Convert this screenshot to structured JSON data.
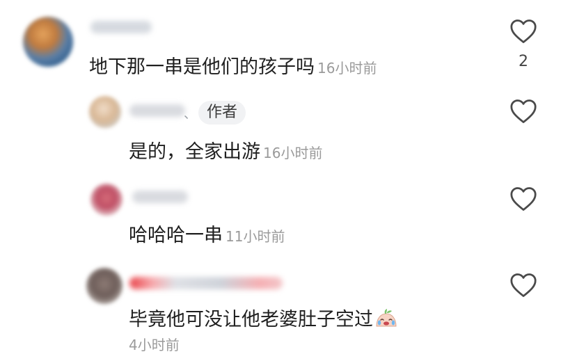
{
  "comments": {
    "main": {
      "text": "地下那一串是他们的孩子吗",
      "time": "16小时前",
      "like_count": "2"
    },
    "replies": [
      {
        "author_badge": "作者",
        "separator": "、",
        "text": "是的，全家出游",
        "time": "16小时前"
      },
      {
        "text": "哈哈哈一串",
        "time": "11小时前"
      },
      {
        "text": "毕竟他可没让他老婆肚子空过",
        "time": "4小时前",
        "emoji": "crying-laughing-emoji"
      }
    ]
  },
  "icons": {
    "like": "heart-outline-icon"
  },
  "colors": {
    "text": "#1f1f1f",
    "timestamp": "#9a9a9a",
    "heart_stroke": "#4a4a4a",
    "badge_bg": "#f1f2f4"
  }
}
